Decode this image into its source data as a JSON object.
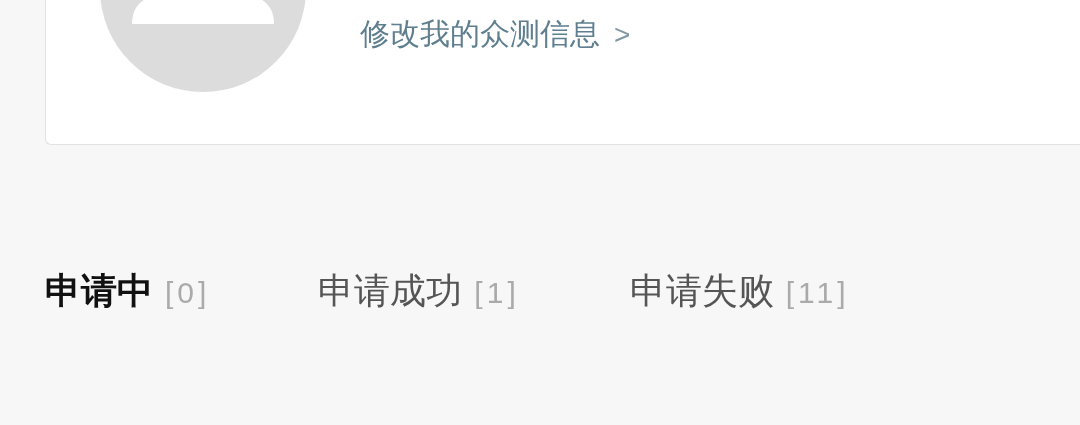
{
  "profile": {
    "edit_link": "修改我的众测信息",
    "edit_link_arrow": ">"
  },
  "tabs": [
    {
      "label": "申请中",
      "count": "[0]",
      "selected": true
    },
    {
      "label": "申请成功",
      "count": "[1]",
      "selected": false
    },
    {
      "label": "申请失败",
      "count": "[11]",
      "selected": false
    }
  ]
}
